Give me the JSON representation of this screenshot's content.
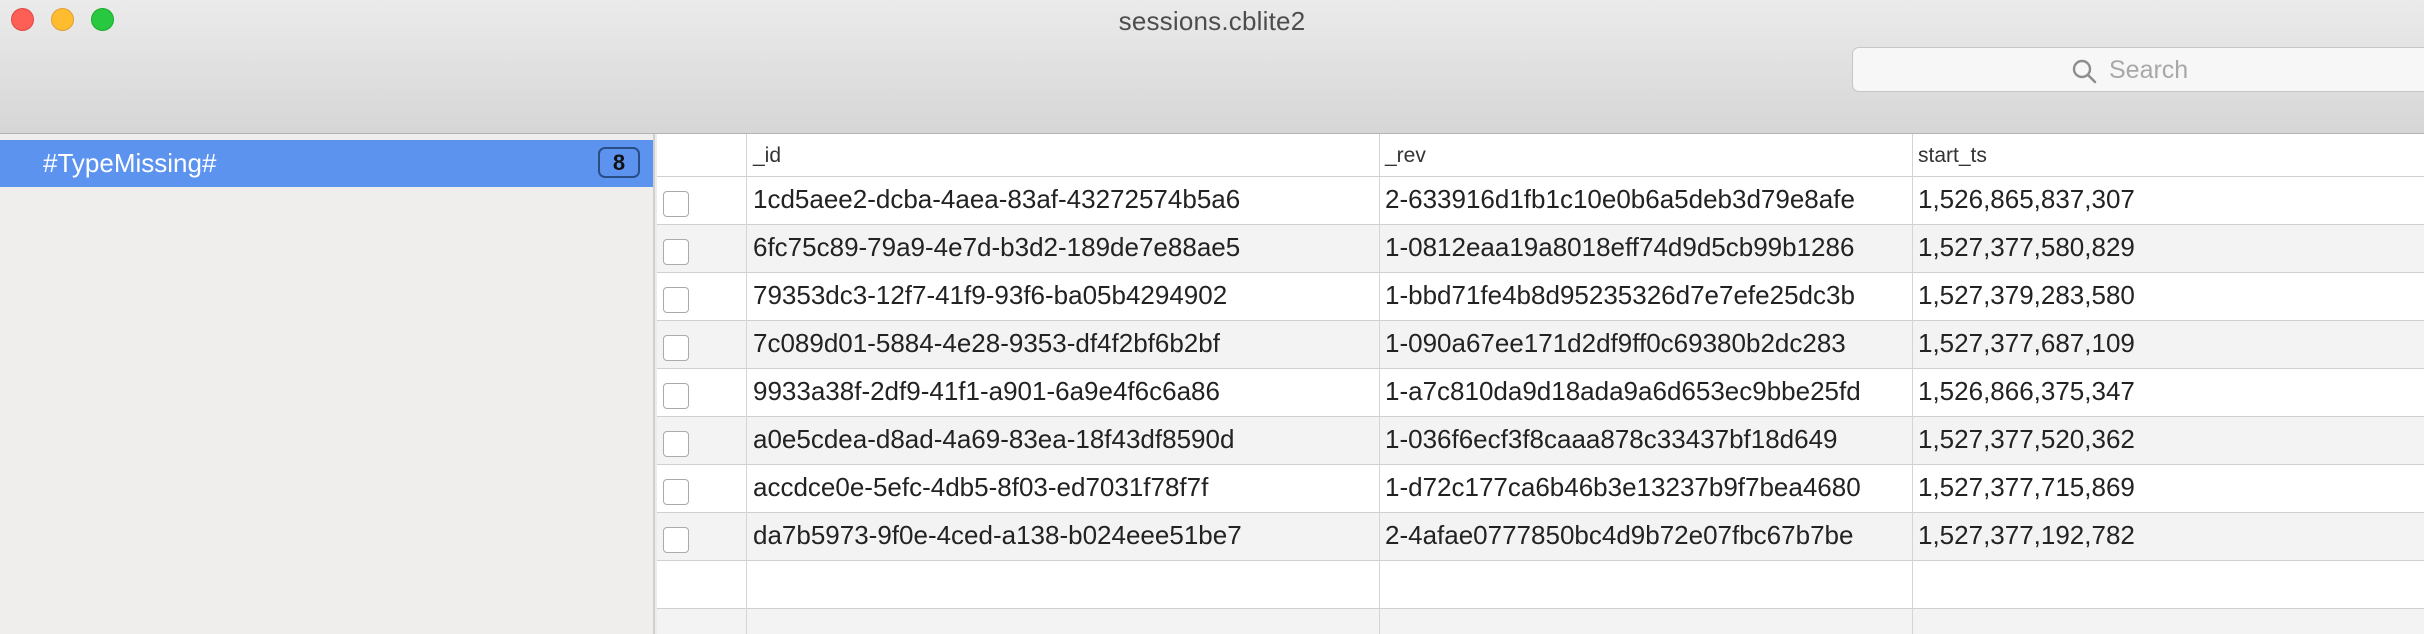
{
  "window": {
    "title": "sessions.cblite2"
  },
  "search": {
    "placeholder": "Search"
  },
  "sidebar": {
    "items": [
      {
        "label": "#TypeMissing#",
        "count": "8"
      }
    ]
  },
  "table": {
    "columns": [
      "",
      "_id",
      "_rev",
      "start_ts"
    ],
    "rows": [
      {
        "id": "1cd5aee2-dcba-4aea-83af-43272574b5a6",
        "rev": "2-633916d1fb1c10e0b6a5deb3d79e8afe",
        "start_ts": "1,526,865,837,307"
      },
      {
        "id": "6fc75c89-79a9-4e7d-b3d2-189de7e88ae5",
        "rev": "1-0812eaa19a8018eff74d9d5cb99b1286",
        "start_ts": "1,527,377,580,829"
      },
      {
        "id": "79353dc3-12f7-41f9-93f6-ba05b4294902",
        "rev": "1-bbd71fe4b8d95235326d7e7efe25dc3b",
        "start_ts": "1,527,379,283,580"
      },
      {
        "id": "7c089d01-5884-4e28-9353-df4f2bf6b2bf",
        "rev": "1-090a67ee171d2df9ff0c69380b2dc283",
        "start_ts": "1,527,377,687,109"
      },
      {
        "id": "9933a38f-2df9-41f1-a901-6a9e4f6c6a86",
        "rev": "1-a7c810da9d18ada9a6d653ec9bbe25fd",
        "start_ts": "1,526,866,375,347"
      },
      {
        "id": "a0e5cdea-d8ad-4a69-83ea-18f43df8590d",
        "rev": "1-036f6ecf3f8caaa878c33437bf18d649",
        "start_ts": "1,527,377,520,362"
      },
      {
        "id": "accdce0e-5efc-4db5-8f03-ed7031f78f7f",
        "rev": "1-d72c177ca6b46b3e13237b9f7bea4680",
        "start_ts": "1,527,377,715,869"
      },
      {
        "id": "da7b5973-9f0e-4ced-a138-b024eee51be7",
        "rev": "2-4afae0777850bc4d9b72e07fbc67b7be",
        "start_ts": "1,527,377,192,782"
      }
    ]
  }
}
